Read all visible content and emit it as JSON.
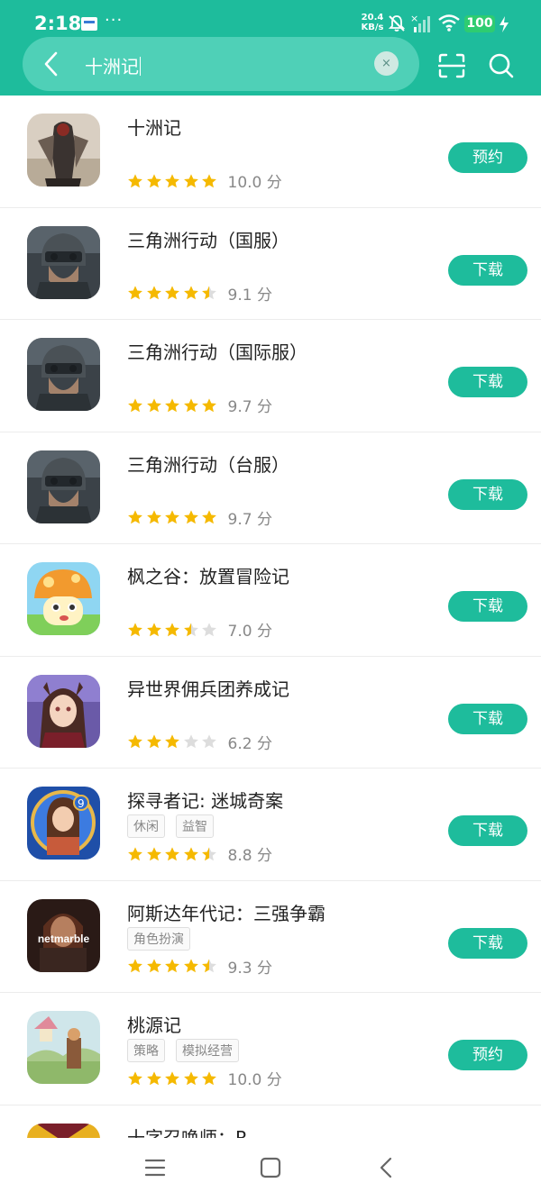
{
  "status_bar": {
    "time": "2:18",
    "dots": "···",
    "net_speed_value": "20.4",
    "net_speed_unit": "KB/s",
    "battery": "100"
  },
  "search": {
    "query": "十洲记",
    "clear_label": "×"
  },
  "colors": {
    "accent": "#1ebc9c",
    "star_filled": "#f5b900",
    "star_empty": "#dddddd"
  },
  "apps": [
    {
      "name": "十洲记",
      "tags": [],
      "rating": 5.0,
      "score": "10.0 分",
      "button": "预约",
      "icon": "dark-figure-game-icon"
    },
    {
      "name": "三角洲行动（国服）",
      "tags": [],
      "rating": 4.5,
      "score": "9.1 分",
      "button": "下载",
      "icon": "soldier-helmet-game-icon"
    },
    {
      "name": "三角洲行动（国际服）",
      "tags": [],
      "rating": 5.0,
      "score": "9.7 分",
      "button": "下载",
      "icon": "soldier-helmet-game-icon"
    },
    {
      "name": "三角洲行动（台服）",
      "tags": [],
      "rating": 5.0,
      "score": "9.7 分",
      "button": "下载",
      "icon": "soldier-helmet-game-icon"
    },
    {
      "name": "枫之谷：放置冒险记",
      "tags": [],
      "rating": 3.5,
      "score": "7.0 分",
      "button": "下载",
      "icon": "mushroom-character-game-icon"
    },
    {
      "name": "异世界佣兵团养成记",
      "tags": [],
      "rating": 3.0,
      "score": "6.2 分",
      "button": "下载",
      "icon": "anime-girl-game-icon"
    },
    {
      "name": "探寻者记: 迷城奇案",
      "tags": [
        "休闲",
        "益智"
      ],
      "rating": 4.5,
      "score": "8.8 分",
      "button": "下载",
      "icon": "detective-woman-game-icon"
    },
    {
      "name": "阿斯达年代记：三强争霸",
      "tags": [
        "角色扮演"
      ],
      "rating": 4.5,
      "score": "9.3 分",
      "button": "下载",
      "icon": "netmarble-warrior-game-icon",
      "icon_text": "netmarble"
    },
    {
      "name": "桃源记",
      "tags": [
        "策略",
        "模拟经营"
      ],
      "rating": 5.0,
      "score": "10.0 分",
      "button": "预约",
      "icon": "village-scene-game-icon"
    },
    {
      "name": "十字召唤师：R",
      "tags": [],
      "rating": null,
      "score": "",
      "button": "",
      "icon": "summoner-game-icon"
    }
  ],
  "nav_bar": {
    "menu": "menu-icon",
    "home": "home-icon",
    "back": "back-icon"
  }
}
